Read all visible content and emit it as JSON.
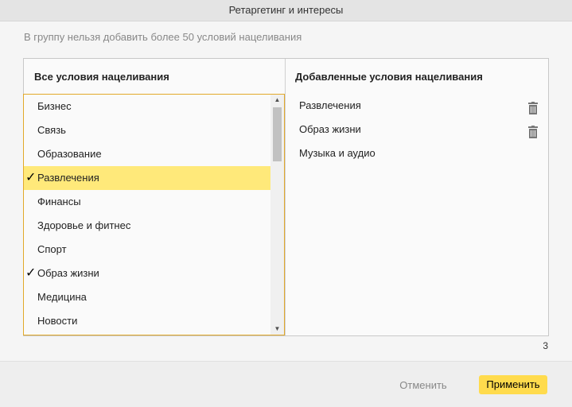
{
  "dialog": {
    "title": "Ретаргетинг и интересы",
    "notice": "В группу нельзя добавить более 50 условий нацеливания"
  },
  "all_conditions": {
    "header": "Все условия нацеливания",
    "items": [
      {
        "label": "Бизнес",
        "checked": false
      },
      {
        "label": "Связь",
        "checked": false
      },
      {
        "label": "Образование",
        "checked": false
      },
      {
        "label": "Развлечения",
        "checked": true
      },
      {
        "label": "Финансы",
        "checked": false
      },
      {
        "label": "Здоровье и фитнес",
        "checked": false
      },
      {
        "label": "Спорт",
        "checked": false
      },
      {
        "label": "Образ жизни",
        "checked": true
      },
      {
        "label": "Медицина",
        "checked": false
      },
      {
        "label": "Новости",
        "checked": false
      }
    ],
    "check_glyph": "✓"
  },
  "added_conditions": {
    "header": "Добавленные условия нацеливания",
    "items": [
      {
        "label": "Развлечения",
        "icon": "trash-icon"
      },
      {
        "label": "Образ жизни",
        "icon": "trash-icon"
      },
      {
        "label": "Музыка и аудио",
        "icon": null
      }
    ]
  },
  "count": "3",
  "footer": {
    "cancel_label": "Отменить",
    "apply_label": "Применить"
  },
  "colors": {
    "accent": "#ffdb4d",
    "selected_row": "#ffe97a",
    "list_border": "#e2a92a"
  }
}
